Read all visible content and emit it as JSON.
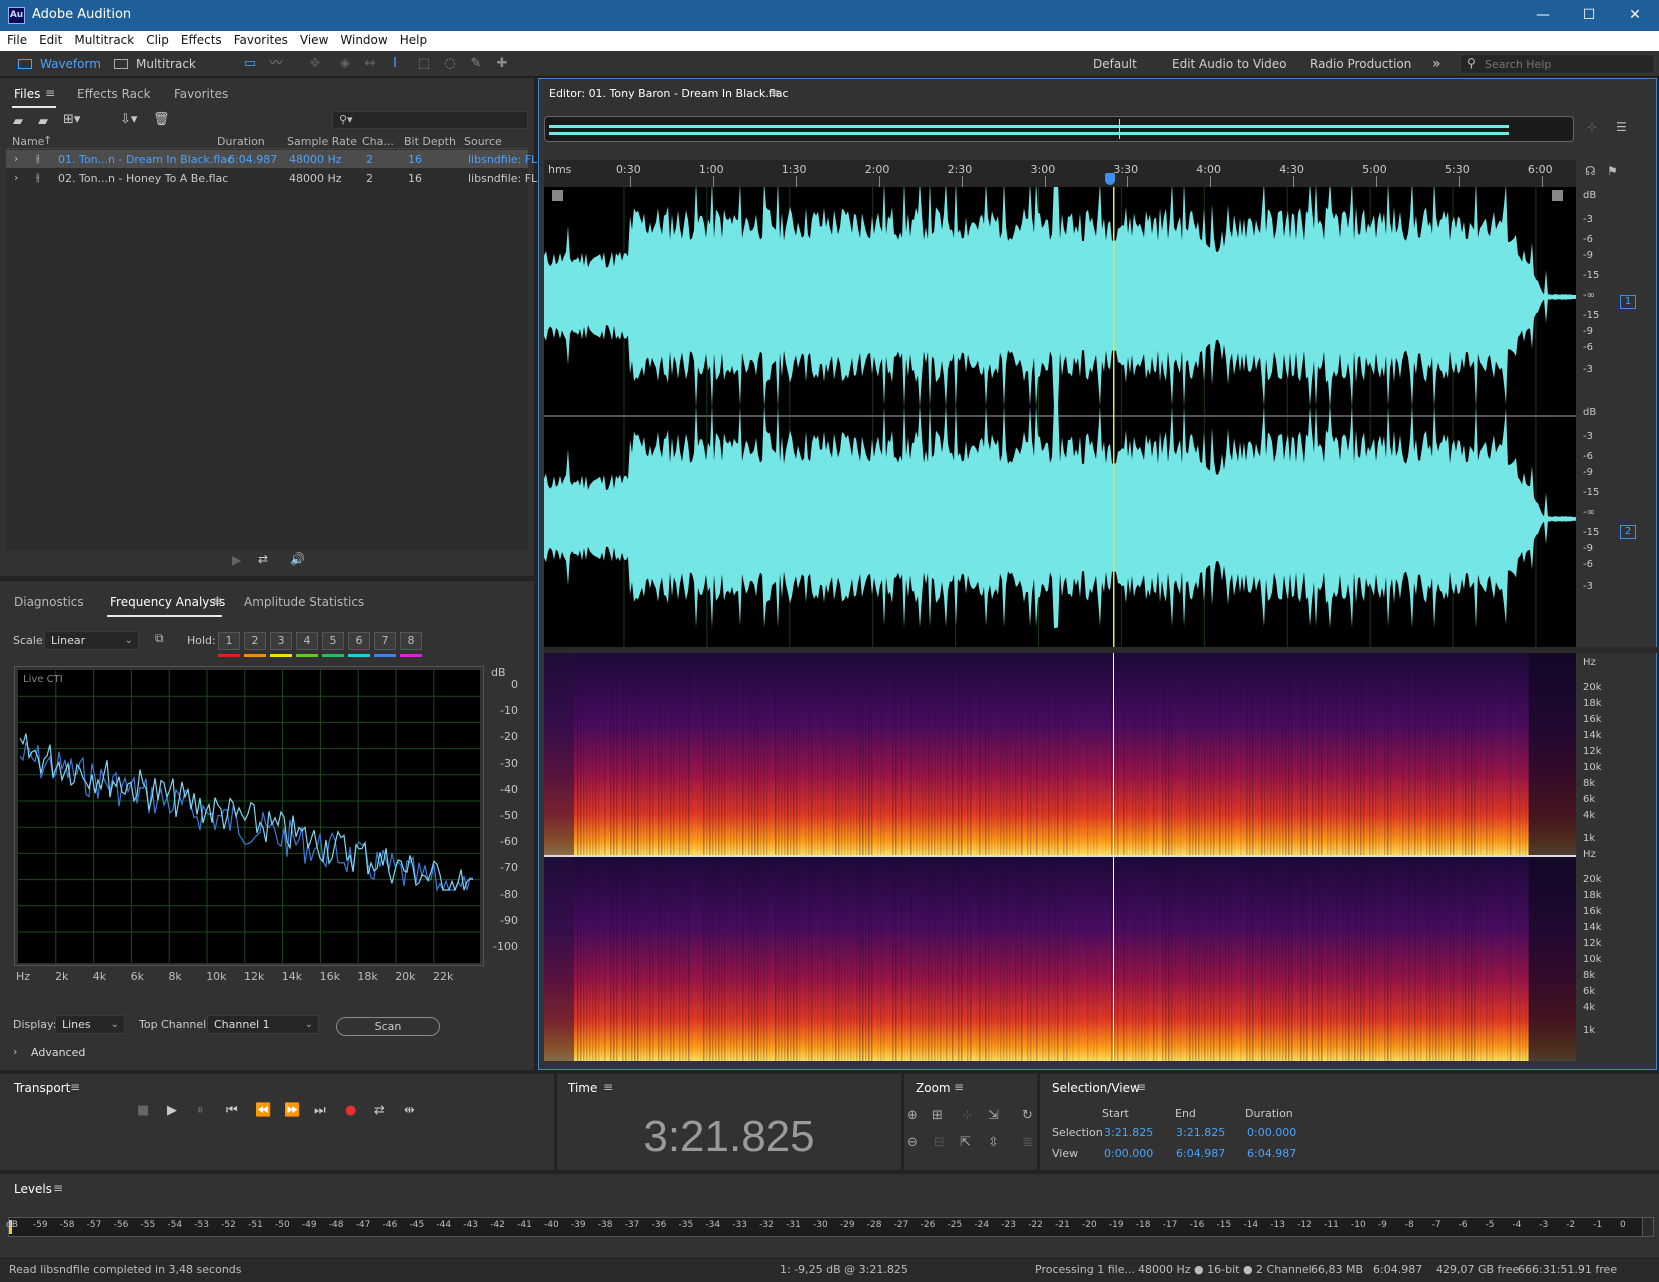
{
  "window": {
    "title": "Adobe Audition",
    "app_icon": "Au",
    "minimize": "—",
    "maximize": "☐",
    "close": "✕"
  },
  "menu": [
    "File",
    "Edit",
    "Multitrack",
    "Clip",
    "Effects",
    "Favorites",
    "View",
    "Window",
    "Help"
  ],
  "toolbar": {
    "waveform": "Waveform",
    "multitrack": "Multitrack",
    "workspaces": [
      "Default",
      "Edit Audio to Video",
      "Radio Production"
    ],
    "more": "»",
    "search_placeholder": "Search Help"
  },
  "files_panel": {
    "tabs": [
      "Files",
      "Effects Rack",
      "Favorites"
    ],
    "search_icon": "⚲▾",
    "columns": [
      "Name",
      "Duration",
      "Sample Rate",
      "Cha...",
      "Bit Depth",
      "Source Forma"
    ],
    "sort_arrow": "↑",
    "rows": [
      {
        "name": "01. Ton...n - Dream In Black.flac",
        "duration": "6:04.987",
        "rate": "48000 Hz",
        "channels": "2",
        "bits": "16",
        "format": "libsndfile: FL"
      },
      {
        "name": "02. Ton...n - Honey To A Be.flac",
        "duration": "",
        "rate": "48000 Hz",
        "channels": "2",
        "bits": "16",
        "format": "libsndfile: FL"
      }
    ]
  },
  "freq_panel": {
    "tabs": [
      "Diagnostics",
      "Frequency Analysis",
      "Amplitude Statistics"
    ],
    "scale_label": "Scale:",
    "scale_value": "Linear",
    "hold_label": "Hold:",
    "hold_buttons": [
      "1",
      "2",
      "3",
      "4",
      "5",
      "6",
      "7",
      "8"
    ],
    "hold_colors": [
      "#e02020",
      "#ff8a00",
      "#f0e010",
      "#60d020",
      "#20c060",
      "#20d0e0",
      "#3a80ff",
      "#e020e0"
    ],
    "live_label": "Live CTI",
    "db_label": "dB",
    "db_ticks": [
      "0",
      "-10",
      "-20",
      "-30",
      "-40",
      "-50",
      "-60",
      "-70",
      "-80",
      "-90",
      "-100"
    ],
    "hz_ticks": [
      "Hz",
      "2k",
      "4k",
      "6k",
      "8k",
      "10k",
      "12k",
      "14k",
      "16k",
      "18k",
      "20k",
      "22k"
    ],
    "display_label": "Display:",
    "display_value": "Lines",
    "top_channel_label": "Top Channel:",
    "top_channel_value": "Channel 1",
    "scan": "Scan",
    "advanced": "Advanced"
  },
  "editor": {
    "title": "Editor: 01. Tony Baron - Dream In Black.flac",
    "ruler": [
      "hms",
      "0:30",
      "1:00",
      "1:30",
      "2:00",
      "2:30",
      "3:00",
      "3:30",
      "4:00",
      "4:30",
      "5:00",
      "5:30",
      "6:00"
    ],
    "db_labels": [
      "dB",
      "-3",
      "-6",
      "-9",
      "-15",
      "-∞",
      "-15",
      "-9",
      "-6",
      "-3"
    ],
    "channel_badges": [
      "1",
      "2"
    ],
    "hz_labels": [
      "Hz",
      "20k",
      "18k",
      "16k",
      "14k",
      "12k",
      "10k",
      "8k",
      "6k",
      "4k",
      "1k"
    ],
    "waveform_color": "#74e6e6",
    "playhead_color": "#e8e830"
  },
  "transport": {
    "title": "Transport"
  },
  "time_panel": {
    "title": "Time",
    "value": "3:21.825"
  },
  "zoom_panel": {
    "title": "Zoom"
  },
  "selection_panel": {
    "title": "Selection/View",
    "headers": [
      "Start",
      "End",
      "Duration"
    ],
    "selection_label": "Selection",
    "view_label": "View",
    "selection": [
      "3:21.825",
      "3:21.825",
      "0:00.000"
    ],
    "view": [
      "0:00.000",
      "6:04.987",
      "6:04.987"
    ]
  },
  "levels": {
    "title": "Levels",
    "scale": [
      "dB",
      "-59",
      "-58",
      "-57",
      "-56",
      "-55",
      "-54",
      "-53",
      "-52",
      "-51",
      "-50",
      "-49",
      "-48",
      "-47",
      "-46",
      "-45",
      "-44",
      "-43",
      "-42",
      "-41",
      "-40",
      "-39",
      "-38",
      "-37",
      "-36",
      "-35",
      "-34",
      "-33",
      "-32",
      "-31",
      "-30",
      "-29",
      "-28",
      "-27",
      "-26",
      "-25",
      "-24",
      "-23",
      "-22",
      "-21",
      "-20",
      "-19",
      "-18",
      "-17",
      "-16",
      "-15",
      "-14",
      "-13",
      "-12",
      "-11",
      "-10",
      "-9",
      "-8",
      "-7",
      "-6",
      "-5",
      "-4",
      "-3",
      "-2",
      "-1",
      "0"
    ]
  },
  "statusbar": {
    "message": "Read libsndfile completed in 3,48 seconds",
    "cursor": "1: -9,25 dB @ 3:21.825",
    "processing": "Processing 1 file...",
    "format": "48000 Hz ● 16-bit ● 2 Channel",
    "size": "66,83 MB",
    "duration": "6:04.987",
    "disk": "429,07 GB free",
    "free_time": "666:31:51.91 free"
  }
}
